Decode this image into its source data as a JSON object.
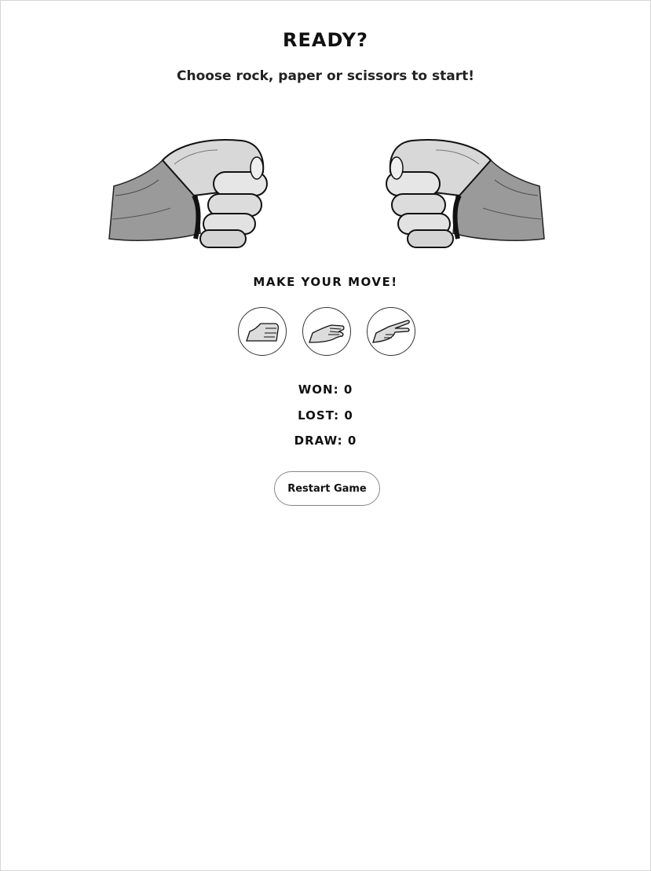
{
  "header": {
    "title": "READY?",
    "subtitle": "Choose rock, paper or scissors to start!"
  },
  "arena": {
    "player_hand_icon": "fist-icon",
    "computer_hand_icon": "fist-icon"
  },
  "moves": {
    "prompt": "MAKE YOUR MOVE!",
    "options": [
      {
        "name": "rock",
        "icon": "rock-hand-icon"
      },
      {
        "name": "paper",
        "icon": "paper-hand-icon"
      },
      {
        "name": "scissors",
        "icon": "scissors-hand-icon"
      }
    ]
  },
  "score": {
    "won_label": "WON:",
    "won": "0",
    "lost_label": "LOST:",
    "lost": "0",
    "draw_label": "DRAW:",
    "draw": "0"
  },
  "controls": {
    "restart_label": "Restart Game"
  }
}
